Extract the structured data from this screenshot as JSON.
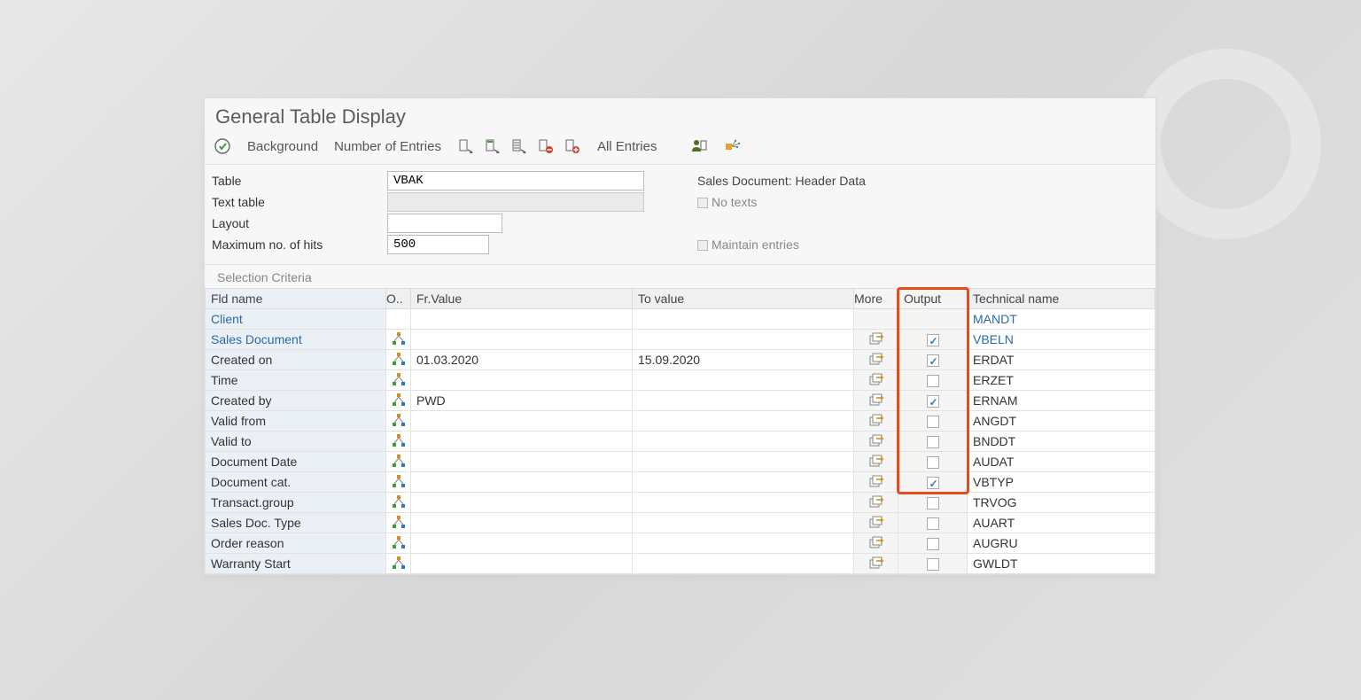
{
  "title": "General Table Display",
  "toolbar": {
    "background": "Background",
    "entries": "Number of Entries",
    "all_entries": "All Entries"
  },
  "form": {
    "table_label": "Table",
    "table_value": "VBAK",
    "table_desc": "Sales Document: Header Data",
    "texttable_label": "Text table",
    "texttable_value": "",
    "no_texts": "No texts",
    "layout_label": "Layout",
    "layout_value": "",
    "maxhits_label": "Maximum no. of hits",
    "maxhits_value": "500",
    "maintain": "Maintain entries"
  },
  "section": "Selection Criteria",
  "cols": {
    "name": "Fld name",
    "op": "O..",
    "from": "Fr.Value",
    "to": "To value",
    "more": "More",
    "output": "Output",
    "tech": "Technical name"
  },
  "rows": [
    {
      "name": "Client",
      "op": false,
      "from": "",
      "to": "",
      "more": false,
      "out": null,
      "tech": "MANDT",
      "link": true,
      "hl": false
    },
    {
      "name": "Sales Document",
      "op": true,
      "from": "",
      "to": "",
      "more": true,
      "out": true,
      "tech": "VBELN",
      "link": true,
      "hl": true
    },
    {
      "name": "Created on",
      "op": true,
      "from": "01.03.2020",
      "to": "15.09.2020",
      "more": true,
      "out": true,
      "tech": "ERDAT",
      "link": false,
      "hl": true
    },
    {
      "name": "Time",
      "op": true,
      "from": "",
      "to": "",
      "more": true,
      "out": false,
      "tech": "ERZET",
      "link": false,
      "hl": true
    },
    {
      "name": "Created by",
      "op": true,
      "from": "PWD",
      "to": "",
      "more": true,
      "out": true,
      "tech": "ERNAM",
      "link": false,
      "hl": true
    },
    {
      "name": "Valid from",
      "op": true,
      "from": "",
      "to": "",
      "more": true,
      "out": false,
      "tech": "ANGDT",
      "link": false,
      "hl": true
    },
    {
      "name": "Valid to",
      "op": true,
      "from": "",
      "to": "",
      "more": true,
      "out": false,
      "tech": "BNDDT",
      "link": false,
      "hl": true
    },
    {
      "name": "Document Date",
      "op": true,
      "from": "",
      "to": "",
      "more": true,
      "out": false,
      "tech": "AUDAT",
      "link": false,
      "hl": true
    },
    {
      "name": "Document cat.",
      "op": true,
      "from": "",
      "to": "",
      "more": true,
      "out": true,
      "tech": "VBTYP",
      "link": false,
      "hl": true
    },
    {
      "name": "Transact.group",
      "op": true,
      "from": "",
      "to": "",
      "more": true,
      "out": false,
      "tech": "TRVOG",
      "link": false,
      "hl": false
    },
    {
      "name": "Sales Doc. Type",
      "op": true,
      "from": "",
      "to": "",
      "more": true,
      "out": false,
      "tech": "AUART",
      "link": false,
      "hl": false
    },
    {
      "name": "Order reason",
      "op": true,
      "from": "",
      "to": "",
      "more": true,
      "out": false,
      "tech": "AUGRU",
      "link": false,
      "hl": false
    },
    {
      "name": "Warranty Start",
      "op": true,
      "from": "",
      "to": "",
      "more": true,
      "out": false,
      "tech": "GWLDT",
      "link": false,
      "hl": false
    }
  ]
}
